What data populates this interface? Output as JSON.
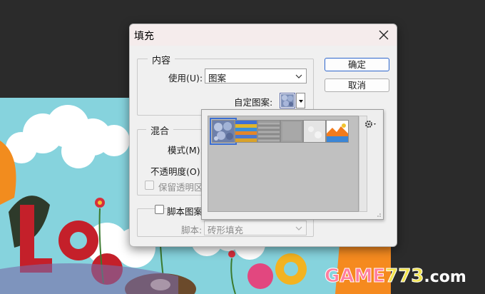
{
  "dialog": {
    "title": "填充"
  },
  "content_group": {
    "label": "内容",
    "use_label": "使用(U):",
    "use_value": "图案",
    "custom_pattern_label": "自定图案:"
  },
  "blend_group": {
    "label": "混合",
    "mode_label": "模式(M):",
    "opacity_label": "不透明度(O):",
    "preserve_transparency_label": "保留透明区"
  },
  "script_group": {
    "checkbox_label": "脚本图案",
    "script_label": "脚本:",
    "script_value": "砖形填充"
  },
  "buttons": {
    "ok": "确定",
    "cancel": "取消"
  },
  "pattern_picker": {
    "selected_index": 0,
    "patterns": [
      {
        "icon": "bubbles-pattern"
      },
      {
        "icon": "rainbow-stripes-pattern"
      },
      {
        "icon": "gray-noise-pattern"
      },
      {
        "icon": "gray-canvas-pattern"
      },
      {
        "icon": "light-white-pattern"
      },
      {
        "icon": "landscape-pattern"
      }
    ]
  },
  "watermark": {
    "part1": "GAME",
    "part2": "773",
    "part3": ".com"
  },
  "colors": {
    "accent": "#2d66cc",
    "dialog_bg": "#f0f0f0",
    "titlebar_bg": "#f5ecec"
  }
}
